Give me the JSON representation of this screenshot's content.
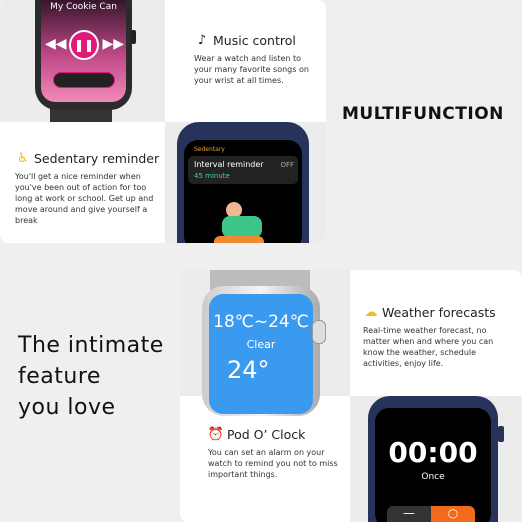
{
  "headline_multifunction": "MULTIFUNCTION",
  "headline_intimate": [
    "The intimate",
    "feature",
    "you love"
  ],
  "music": {
    "title": "Music control",
    "desc": "Wear a watch and listen to your many favorite songs on your wrist at all times.",
    "screen_song": "My Cookie Can"
  },
  "sedentary": {
    "title": "Sedentary reminder",
    "desc": "You'll get a nice reminder when you've been out of action for too long at work or school.  Get up and move around and give yourself a break",
    "screen_header": "Sedentary",
    "screen_item": "Interval reminder",
    "screen_toggle": "OFF",
    "screen_value": "45 minute"
  },
  "weather": {
    "title": "Weather forecasts",
    "desc": "Real-time weather forecast, no matter when and where you can know the weather, schedule activities, enjoy life.",
    "screen_range": "18℃~24℃",
    "screen_condition": "Clear",
    "screen_temp": "24°"
  },
  "clock": {
    "title": "Pod O’  Clock",
    "desc": "You can set an alarm on your watch to remind you not to miss important things.",
    "screen_time": "00:00",
    "screen_repeat": "Once"
  },
  "colors": {
    "music_accent": "#e0197a",
    "weather_screen": "#3a9af0",
    "alarm_orange": "#f26a1b",
    "watch_navy": "#27335a"
  }
}
